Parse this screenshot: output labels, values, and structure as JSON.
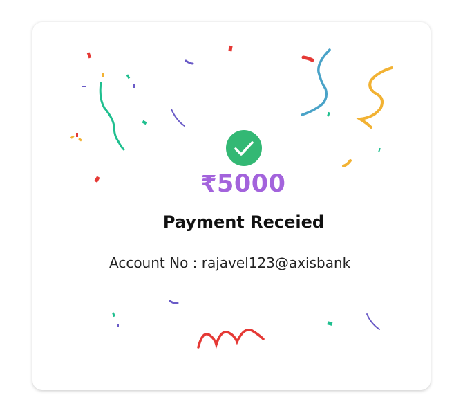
{
  "payment": {
    "currency_symbol": "₹",
    "amount": "5000",
    "status_title": "Payment Receied",
    "account_label": "Account No :",
    "account_value": "rajavel123@axisbank"
  },
  "colors": {
    "success_green": "#33b874",
    "amount_purple": "#a363dc",
    "confetti": [
      "#e53935",
      "#f2b233",
      "#1fbf8f",
      "#6a5bc7",
      "#4aa3c8"
    ]
  },
  "icons": {
    "status": "check-circle-icon"
  }
}
